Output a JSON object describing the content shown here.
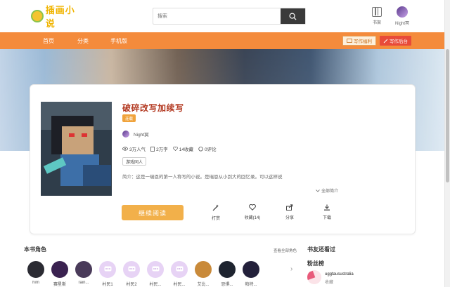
{
  "header": {
    "logo_text": "插画小说",
    "search_placeholder": "搜索",
    "shelf_label": "书架",
    "user_name": "Night冥"
  },
  "nav": {
    "items": [
      "首页",
      "分类",
      "手机版"
    ],
    "welfare_label": "写作福利",
    "backend_label": "写作后台"
  },
  "book": {
    "title": "破碎改写加续写",
    "status": "连载",
    "author": "Night冥",
    "popularity": "3万人气",
    "word_count": "2万字",
    "favorites": "14收藏",
    "comments": "0评论",
    "tag": "游戏同人",
    "intro": "简介：这是一瑞恩的第一人称写的小说。是瑞恩从小到大的回忆录。可以这样说",
    "more_label": "全部简介",
    "read_button": "继续阅读",
    "actions": [
      {
        "label": "打赏",
        "icon": "magic-wand-icon"
      },
      {
        "label": "收藏(14)",
        "icon": "heart-icon"
      },
      {
        "label": "分享",
        "icon": "share-icon"
      },
      {
        "label": "下载",
        "icon": "download-icon"
      }
    ]
  },
  "characters": {
    "title": "本书角色",
    "view_all": "查看全部角色",
    "items": [
      {
        "name": "him",
        "color": "#2b2b33"
      },
      {
        "name": "赛星斯",
        "color": "#3a2250"
      },
      {
        "name": "rain...",
        "color": "#4a3b5a"
      },
      {
        "name": "村民1",
        "color": "#e7d3f5"
      },
      {
        "name": "村民2",
        "color": "#e7d3f5"
      },
      {
        "name": "村民...",
        "color": "#e7d3f5"
      },
      {
        "name": "村民...",
        "color": "#e7d3f5"
      },
      {
        "name": "艾比...",
        "color": "#c98a3a"
      },
      {
        "name": "恐惧...",
        "color": "#1e2430"
      },
      {
        "name": "帕特...",
        "color": "#23203a"
      }
    ]
  },
  "sidebar": {
    "also_read_title": "书友还看过",
    "fans_title": "粉丝榜",
    "fan_name": "uggtausustralia",
    "fan_sub": "收藏"
  }
}
